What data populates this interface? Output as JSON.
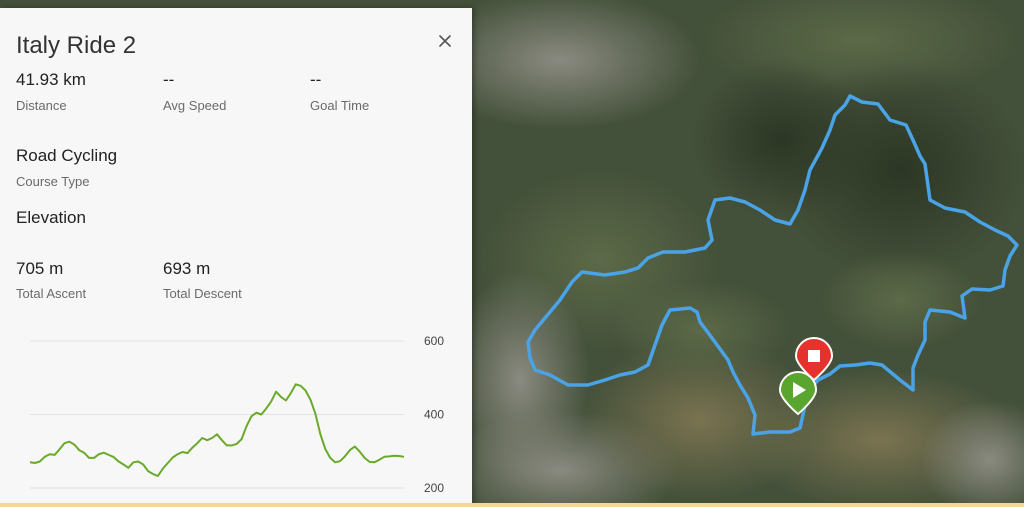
{
  "course": {
    "title": "Italy Ride 2",
    "close_icon": "close-icon"
  },
  "stats": {
    "distance_value": "41.93 km",
    "distance_label": "Distance",
    "avg_speed_value": "--",
    "avg_speed_label": "Avg Speed",
    "goal_time_value": "--",
    "goal_time_label": "Goal Time",
    "course_type_value": "Road Cycling",
    "course_type_label": "Course Type",
    "elevation_heading": "Elevation",
    "ascent_value": "705 m",
    "ascent_label": "Total Ascent",
    "descent_value": "693 m",
    "descent_label": "Total Descent"
  },
  "map": {
    "route_color": "#4aa3e6",
    "start_marker_color": "#5aa52e",
    "end_marker_color": "#e5322d",
    "start_icon": "play-icon",
    "end_icon": "stop-icon"
  },
  "chart_data": {
    "type": "line",
    "title": "",
    "xlabel": "",
    "ylabel": "",
    "ylim": [
      200,
      600
    ],
    "yticks": [
      "600",
      "400",
      "200"
    ],
    "grid": true,
    "line_color": "#6aaa2a",
    "series": [
      {
        "values": [
          270,
          268,
          272,
          285,
          292,
          290,
          305,
          322,
          326,
          318,
          303,
          296,
          282,
          282,
          292,
          296,
          290,
          284,
          272,
          264,
          255,
          270,
          272,
          264,
          246,
          238,
          233,
          253,
          268,
          283,
          292,
          298,
          295,
          310,
          322,
          336,
          330,
          336,
          346,
          330,
          316,
          316,
          320,
          333,
          368,
          395,
          405,
          400,
          416,
          435,
          462,
          448,
          438,
          458,
          482,
          478,
          465,
          440,
          402,
          347,
          306,
          282,
          270,
          273,
          286,
          303,
          313,
          299,
          282,
          271,
          270,
          277,
          285,
          286,
          288,
          287,
          285
        ]
      }
    ]
  }
}
